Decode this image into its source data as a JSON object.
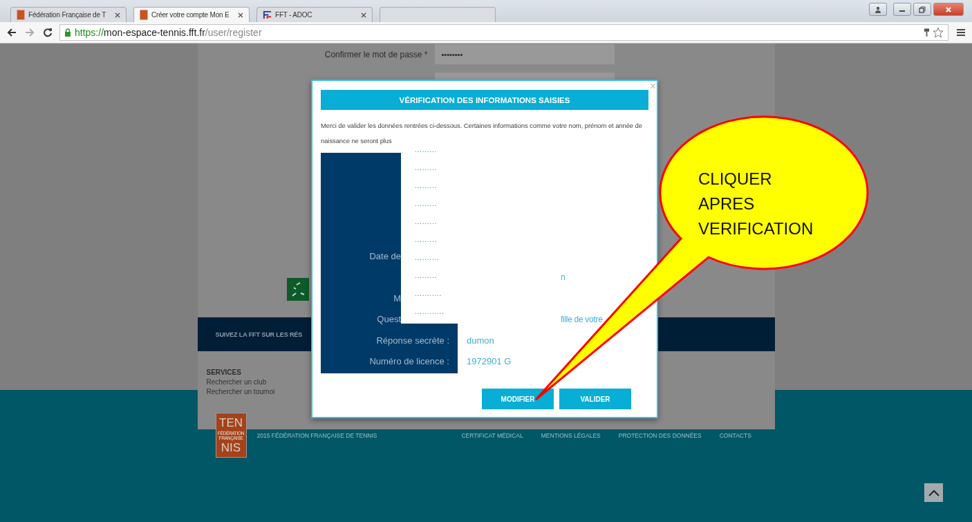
{
  "browser": {
    "tabs": [
      {
        "kind": "orange-logo",
        "title": "Fédération Française de T",
        "selected": false
      },
      {
        "kind": "orange-logo",
        "title": "Créer votre compte Mon E",
        "selected": true
      },
      {
        "kind": "fft-logo",
        "title": "FFT - ADOC",
        "selected": false
      },
      {
        "kind": "blurred",
        "selected": false
      }
    ],
    "address_bar": {
      "scheme": "https://",
      "host": "mon-espace-tennis.fft.fr",
      "path": "/user/register"
    }
  },
  "page": {
    "password_confirm": {
      "label": "Confirmer le mot de passe *",
      "value": "••••••••"
    },
    "social_banner": "SUIVEZ LA FFT SUR LES RÉS",
    "services": {
      "title": "SERVICES",
      "links": [
        "Rechercher un club",
        "Rechercher un tournoi"
      ]
    },
    "footer": {
      "logo": {
        "top": "TEN",
        "middle": "FÉDÉRATION FRANÇAISE",
        "bottom": "NIS"
      },
      "copyright": "2015 FÉDÉRATION FRANÇAISE DE TENNIS",
      "links": [
        "CERTIFICAT MÉDICAL",
        "MENTIONS LÉGALES",
        "PROTECTION DES DONNÉES",
        "CONTACTS"
      ]
    }
  },
  "modal": {
    "title": "VÉRIFICATION DES INFORMATIONS SAISIES",
    "close": "×",
    "intro": "Merci de valider les données rentrées ci-dessous. Certaines informations comme votre nom, prénom et année de naissance ne seront plus",
    "rows": [
      {
        "kind": "covered",
        "label": "Date de"
      },
      {
        "kind": "covered",
        "value": "n"
      },
      {
        "kind": "covered",
        "label": "M"
      },
      {
        "kind": "covered",
        "label": "Quest",
        "value": "fille de votre"
      },
      {
        "kind": "full",
        "label": "Réponse secrète :",
        "value": "dumon"
      },
      {
        "kind": "full",
        "label": "Numéro de licence :",
        "value": "1972901 G"
      }
    ],
    "masked_values": [
      ".........",
      ".........",
      ".........",
      ".........",
      ".........",
      ".........",
      "..........",
      ".........",
      "...........",
      "............"
    ],
    "buttons": [
      "MODIFIER",
      "VALIDER"
    ]
  },
  "callout": {
    "text": "CLIQUER APRES VERIFICATION"
  }
}
